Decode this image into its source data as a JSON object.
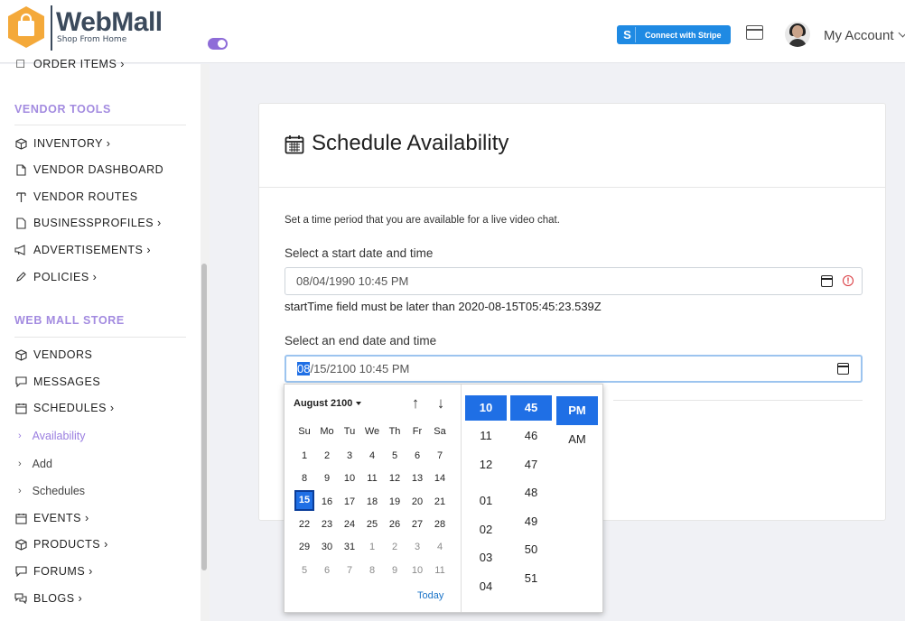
{
  "header": {
    "logo_title": "WebMall",
    "logo_subtitle": "Shop From Home",
    "stripe_label": "Connect with Stripe",
    "stripe_letter": "S",
    "account_label": "My Account"
  },
  "sidebar": {
    "top_item": "ORDER ITEMS ›",
    "sections": [
      {
        "title": "VENDOR TOOLS"
      },
      {
        "title": "WEB MALL STORE"
      }
    ],
    "vendor_tools": [
      {
        "label": "INVENTORY ›",
        "icon": "cube-icon"
      },
      {
        "label": "VENDOR DASHBOARD",
        "icon": "document-icon"
      },
      {
        "label": "VENDOR ROUTES",
        "icon": "route-icon"
      },
      {
        "label": "BUSINESSPROFILES ›",
        "icon": "file-icon"
      },
      {
        "label": "ADVERTISEMENTS ›",
        "icon": "megaphone-icon"
      },
      {
        "label": "POLICIES ›",
        "icon": "pencil-icon"
      }
    ],
    "store_items": [
      {
        "label": "VENDORS",
        "icon": "cube-icon"
      },
      {
        "label": "MESSAGES",
        "icon": "chat-icon"
      },
      {
        "label": "SCHEDULES ›",
        "icon": "calendar-icon"
      }
    ],
    "schedule_sub": [
      {
        "label": "Availability",
        "active": true
      },
      {
        "label": "Add",
        "active": false
      },
      {
        "label": "Schedules",
        "active": false
      }
    ],
    "more_items": [
      {
        "label": "EVENTS ›",
        "icon": "calendar-icon"
      },
      {
        "label": "PRODUCTS ›",
        "icon": "cube-icon"
      },
      {
        "label": "FORUMS ›",
        "icon": "chat-icon"
      },
      {
        "label": "BLOGS ›",
        "icon": "chat-bubbles-icon"
      }
    ],
    "accent_color": "#a38be0"
  },
  "form": {
    "title": "Schedule Availability",
    "intro": "Set a time period that you are available for a live video chat.",
    "start_label": "Select a start date and time",
    "start_value": "08/04/1990 10:45 PM",
    "error": "startTime field must be later than 2020-08-15T05:45:23.539Z",
    "end_label": "Select an end date and time",
    "end_value_selected": "08",
    "end_value_rest": "/15/2100 10:45 PM"
  },
  "picker": {
    "month": "August 2100",
    "weekdays": [
      "Su",
      "Mo",
      "Tu",
      "We",
      "Th",
      "Fr",
      "Sa"
    ],
    "weeks": [
      [
        {
          "d": "1"
        },
        {
          "d": "2"
        },
        {
          "d": "3"
        },
        {
          "d": "4"
        },
        {
          "d": "5"
        },
        {
          "d": "6"
        },
        {
          "d": "7"
        }
      ],
      [
        {
          "d": "8"
        },
        {
          "d": "9"
        },
        {
          "d": "10"
        },
        {
          "d": "11"
        },
        {
          "d": "12"
        },
        {
          "d": "13"
        },
        {
          "d": "14"
        }
      ],
      [
        {
          "d": "15",
          "sel": true
        },
        {
          "d": "16"
        },
        {
          "d": "17"
        },
        {
          "d": "18"
        },
        {
          "d": "19"
        },
        {
          "d": "20"
        },
        {
          "d": "21"
        }
      ],
      [
        {
          "d": "22"
        },
        {
          "d": "23"
        },
        {
          "d": "24"
        },
        {
          "d": "25"
        },
        {
          "d": "26"
        },
        {
          "d": "27"
        },
        {
          "d": "28"
        }
      ],
      [
        {
          "d": "29"
        },
        {
          "d": "30"
        },
        {
          "d": "31"
        },
        {
          "d": "1",
          "muted": true
        },
        {
          "d": "2",
          "muted": true
        },
        {
          "d": "3",
          "muted": true
        },
        {
          "d": "4",
          "muted": true
        }
      ],
      [
        {
          "d": "5",
          "muted": true
        },
        {
          "d": "6",
          "muted": true
        },
        {
          "d": "7",
          "muted": true
        },
        {
          "d": "8",
          "muted": true
        },
        {
          "d": "9",
          "muted": true
        },
        {
          "d": "10",
          "muted": true
        },
        {
          "d": "11",
          "muted": true
        }
      ]
    ],
    "today_label": "Today",
    "hours": [
      "10",
      "11",
      "12",
      "01",
      "02",
      "03",
      "04"
    ],
    "minutes": [
      "45",
      "46",
      "47",
      "48",
      "49",
      "50",
      "51"
    ],
    "ampm": [
      "PM",
      "AM"
    ],
    "selected_hour": "10",
    "selected_minute": "45",
    "selected_ampm": "PM",
    "accent_color": "#1f6fe5"
  }
}
